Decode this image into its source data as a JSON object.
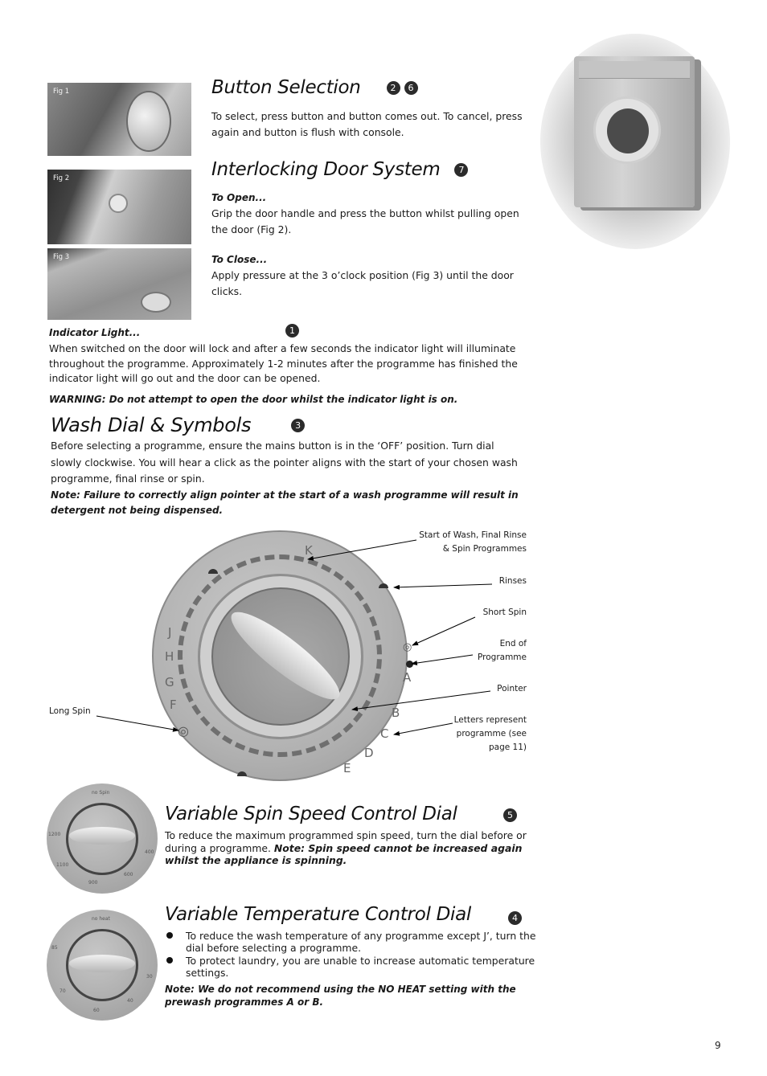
{
  "figures": {
    "fig1": "Fig 1",
    "fig2": "Fig 2",
    "fig3": "Fig 3"
  },
  "button_selection": {
    "title": "Button Selection",
    "badges": [
      "2",
      "6"
    ],
    "text": "To select, press button and button comes out. To cancel, press again and button is flush with console."
  },
  "door_system": {
    "title": "Interlocking Door System",
    "badge": "7",
    "open_heading": "To Open...",
    "open_text": "Grip the door handle and press the button whilst pulling open the door (Fig 2).",
    "close_heading": "To Close...",
    "close_text": "Apply pressure at the 3 o’clock position (Fig 3) until the door clicks."
  },
  "indicator": {
    "heading": "Indicator Light...",
    "badge": "1",
    "text": "When switched on the door will lock and after a few seconds the indicator light will illuminate throughout the programme. Approximately 1-2 minutes after the programme has finished the indicator light will go out and the door can be opened.",
    "warning": "WARNING: Do not attempt to open the door whilst the  indicator light is on."
  },
  "wash_dial": {
    "title": "Wash Dial & Symbols",
    "badge": "3",
    "text": "Before selecting a programme, ensure the mains button is in the ‘OFF’ position. Turn dial slowly clockwise. You will hear a click as the pointer aligns with the start of your chosen wash programme, final rinse or spin.",
    "note": "Note: Failure to correctly align pointer at the start of a wash programme will result in detergent not being dispensed.",
    "dial_letters": [
      "K",
      "J",
      "H",
      "G",
      "F",
      "A",
      "B",
      "C",
      "D",
      "E"
    ],
    "callouts": {
      "start": "Start of Wash, Final Rinse & Spin Programmes",
      "rinses": "Rinses",
      "short_spin": "Short Spin",
      "end": "End of Programme",
      "pointer": "Pointer",
      "letters": "Letters represent programme (see page 11)",
      "long_spin": "Long Spin"
    }
  },
  "spin_dial": {
    "title": "Variable Spin Speed Control Dial",
    "badge": "5",
    "text": "To reduce the maximum programmed spin speed, turn the dial before or during a programme. ",
    "note": "Note: Spin speed cannot be increased again whilst the appliance is spinning.",
    "dial_labels": [
      "no Spin",
      "1200",
      "1100",
      "900",
      "600",
      "400"
    ]
  },
  "temp_dial": {
    "title": "Variable Temperature Control Dial",
    "badge": "4",
    "bullets": [
      "To reduce the wash temperature of any programme except J’,  turn the dial before selecting a programme.",
      "To protect laundry, you are unable to increase automatic temperature settings."
    ],
    "note": "Note: We do not recommend using the NO HEAT setting with the prewash programmes A or B.",
    "dial_labels": [
      "no heat",
      "85",
      "70",
      "60",
      "40",
      "30"
    ]
  },
  "page_number": "9"
}
